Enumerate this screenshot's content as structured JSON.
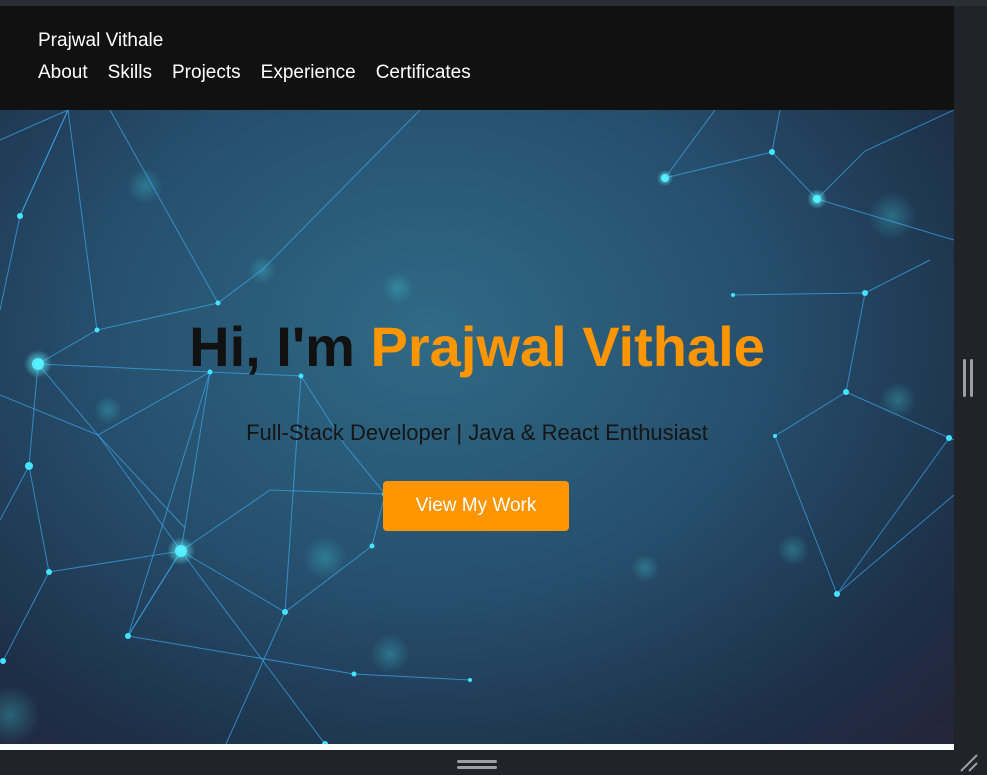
{
  "nav": {
    "brand": "Prajwal Vithale",
    "links": [
      "About",
      "Skills",
      "Projects",
      "Experience",
      "Certificates"
    ]
  },
  "hero": {
    "greeting": "Hi, I'm",
    "name": "Prajwal Vithale",
    "subtitle": "Full-Stack Developer | Java & React Enthusiast",
    "cta_label": "View My Work"
  },
  "colors": {
    "accent": "#ff9500",
    "navbar": "#111111",
    "hero_background": "#264f6d",
    "network_lines": "#3aa8f0",
    "network_nodes": "#43e4ff"
  },
  "icons": {
    "vertical_resize": "vertical-resize-handle-icon",
    "horizontal_resize": "horizontal-resize-handle-icon",
    "corner_grip": "resize-corner-grip-icon"
  }
}
